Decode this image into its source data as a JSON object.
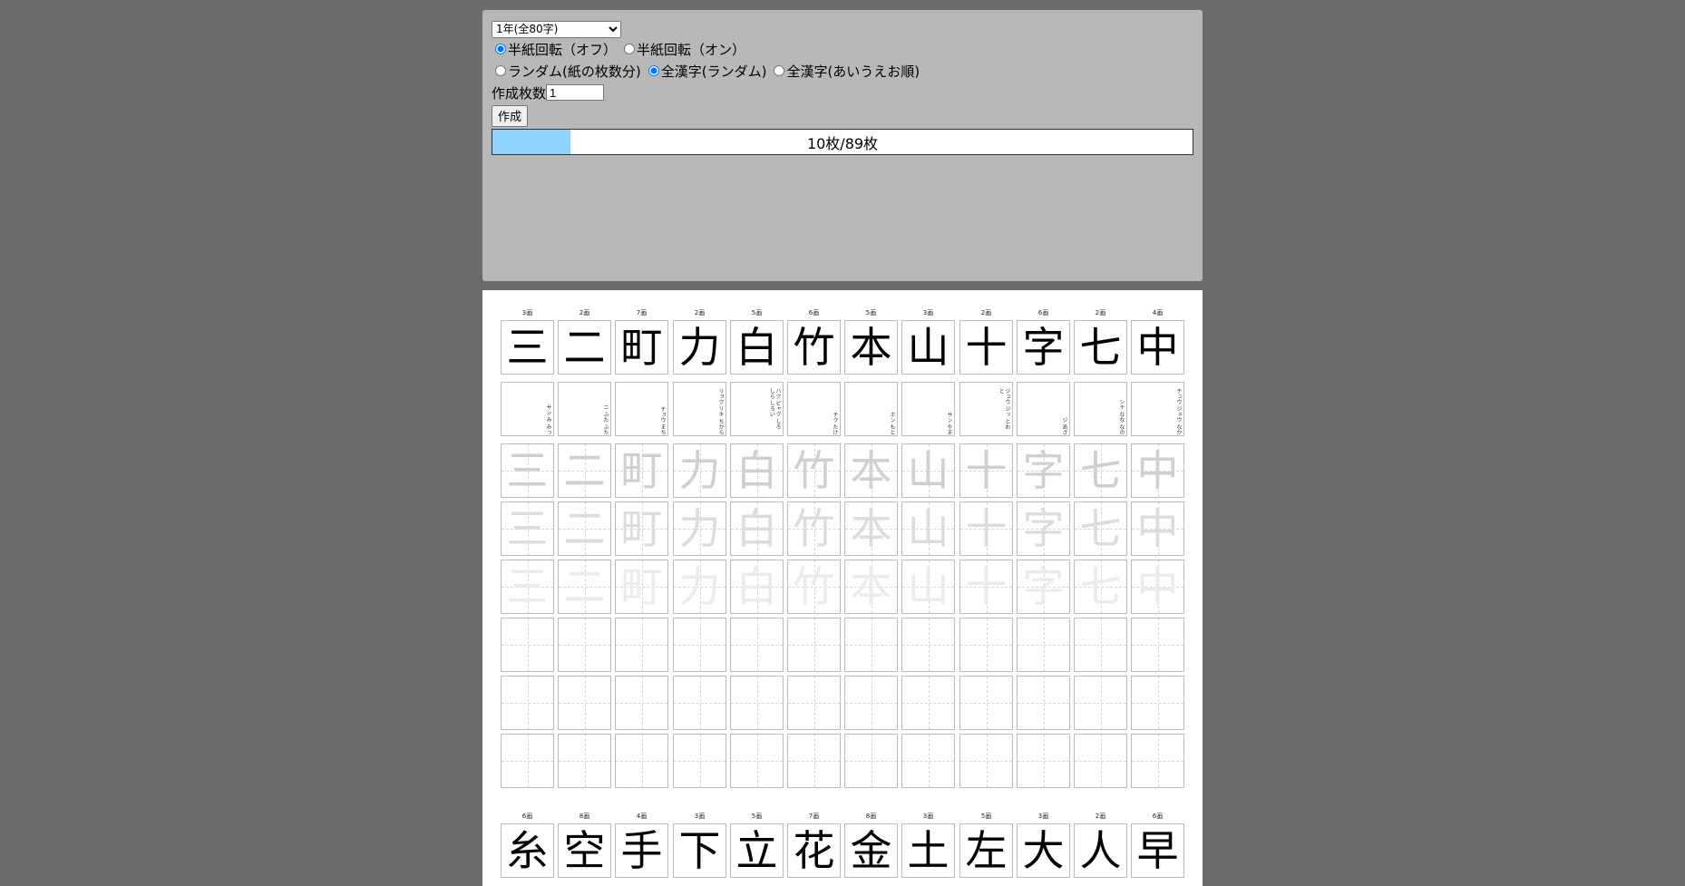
{
  "controls": {
    "grade_select": {
      "selected": "1年(全80字)"
    },
    "rotate_off_label": "半紙回転（オフ）",
    "rotate_on_label": "半紙回転（オン）",
    "mode_random_sheets_label": "ランダム(紙の枚数分)",
    "mode_all_random_label": "全漢字(ランダム)",
    "mode_all_order_label": "全漢字(あいうえお順)",
    "count_label": "作成枚数",
    "count_value": "1",
    "make_button": "作成",
    "progress_text": "10枚/89枚",
    "progress_fraction": 0.112
  },
  "sheet": {
    "block1": {
      "kanji": [
        "三",
        "二",
        "町",
        "力",
        "白",
        "竹",
        "本",
        "山",
        "十",
        "字",
        "七",
        "中"
      ],
      "strokes": [
        "3画",
        "2画",
        "7画",
        "2画",
        "5画",
        "6画",
        "5画",
        "3画",
        "2画",
        "6画",
        "2画",
        "4画"
      ],
      "readings": [
        "サン み みっ",
        "ニ ふた ふた",
        "チョウ まち",
        "リョク リキ ちから",
        "ハク ビャク しろ しら しろい",
        "チク たけ",
        "ホン もと",
        "サン やま",
        "ジュウ ジッ とお と",
        "ジ あざ",
        "シチ なな なの",
        "チュウ ジュウ なか"
      ]
    },
    "block2": {
      "kanji": [
        "糸",
        "空",
        "手",
        "下",
        "立",
        "花",
        "金",
        "土",
        "左",
        "大",
        "人",
        "早"
      ],
      "strokes": [
        "6画",
        "8画",
        "4画",
        "3画",
        "5画",
        "7画",
        "8画",
        "3画",
        "5画",
        "3画",
        "2画",
        "6画"
      ]
    }
  },
  "colors": {
    "progress_fill": "#8fd3ff",
    "background": "#6b6b6b",
    "panel": "#b8b8b8"
  }
}
